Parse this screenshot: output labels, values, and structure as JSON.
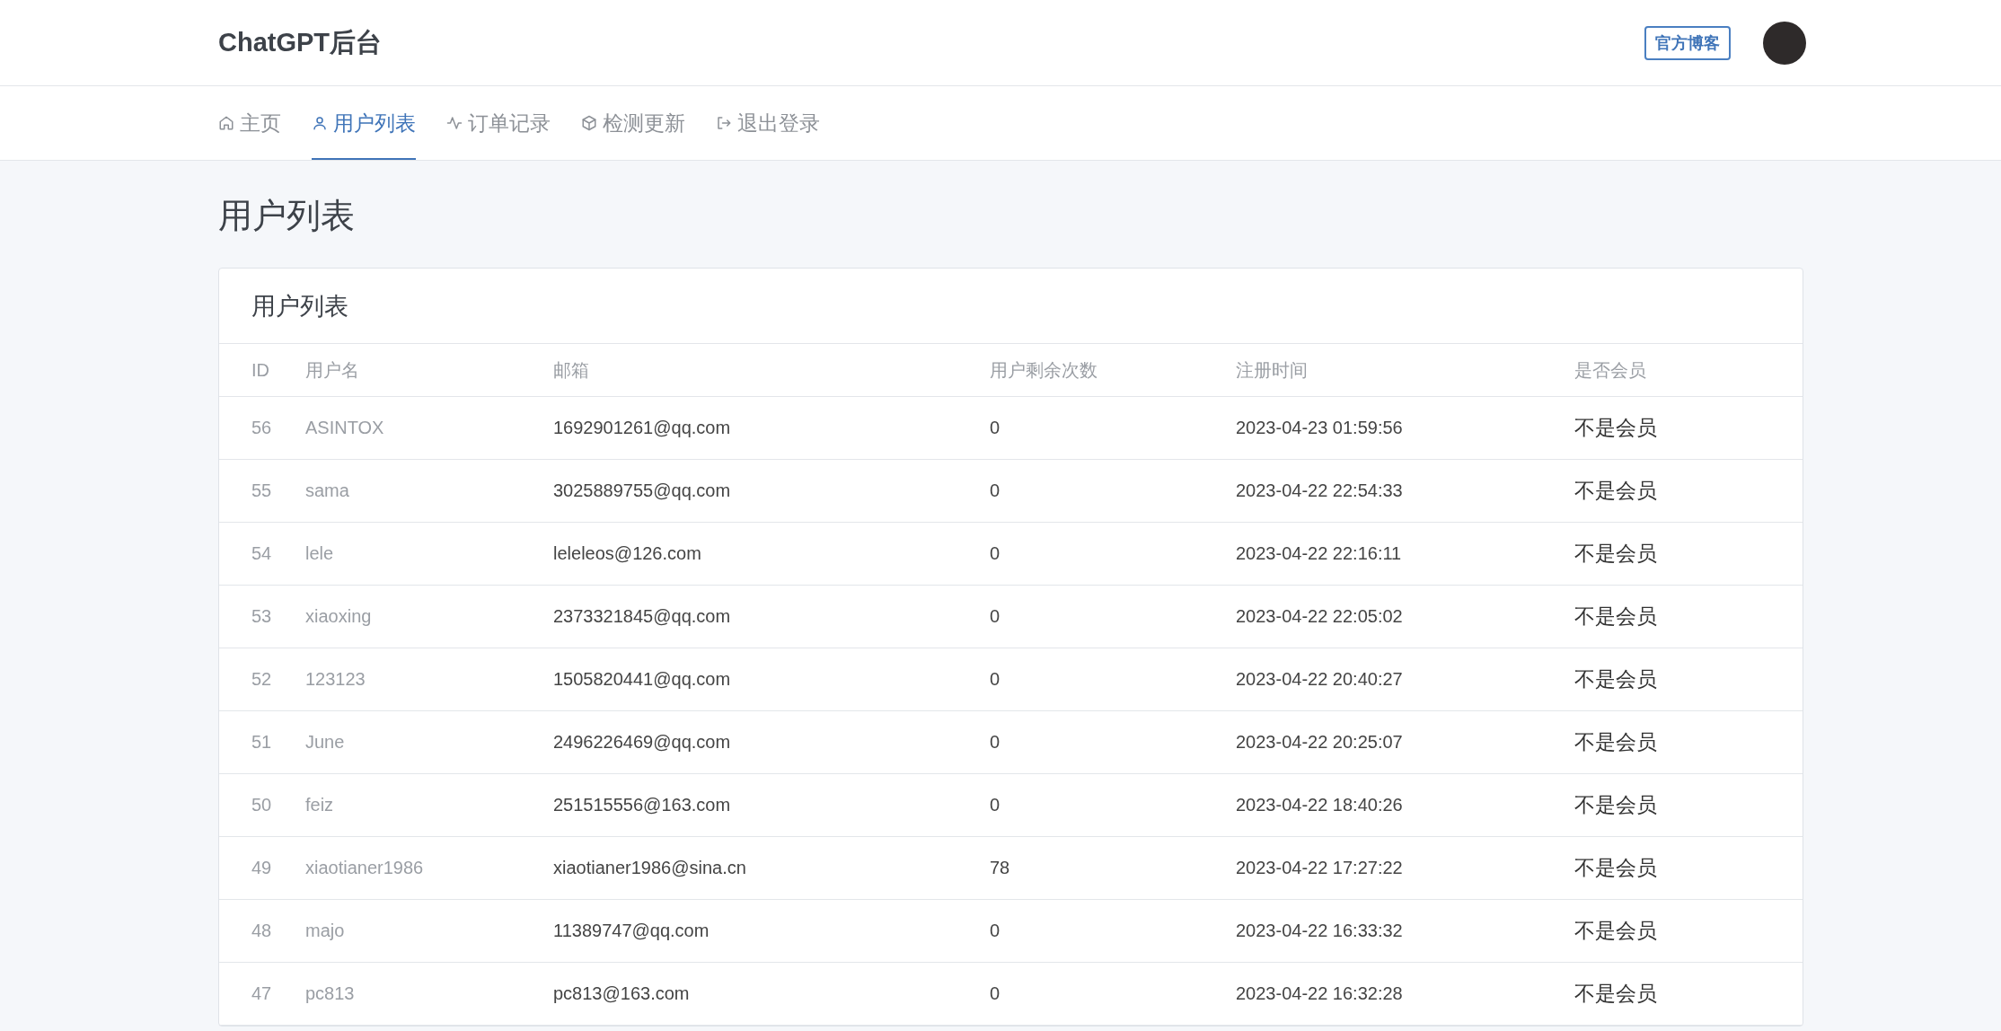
{
  "header": {
    "brand": "ChatGPT后台",
    "blog_button": "官方博客"
  },
  "nav": [
    {
      "label": "主页",
      "selected": false
    },
    {
      "label": "用户列表",
      "selected": true
    },
    {
      "label": "订单记录",
      "selected": false
    },
    {
      "label": "检测更新",
      "selected": false
    },
    {
      "label": "退出登录",
      "selected": false
    }
  ],
  "page_title": "用户列表",
  "card": {
    "title": "用户列表",
    "table": {
      "columns": [
        "ID",
        "用户名",
        "邮箱",
        "用户剩余次数",
        "注册时间",
        "是否会员"
      ],
      "rows": [
        [
          "56",
          "ASINTOX",
          "1692901261@qq.com",
          "0",
          "2023-04-23 01:59:56",
          "不是会员"
        ],
        [
          "55",
          "sama",
          "3025889755@qq.com",
          "0",
          "2023-04-22 22:54:33",
          "不是会员"
        ],
        [
          "54",
          "lele",
          "leleleos@126.com",
          "0",
          "2023-04-22 22:16:11",
          "不是会员"
        ],
        [
          "53",
          "xiaoxing",
          "2373321845@qq.com",
          "0",
          "2023-04-22 22:05:02",
          "不是会员"
        ],
        [
          "52",
          "123123",
          "1505820441@qq.com",
          "0",
          "2023-04-22 20:40:27",
          "不是会员"
        ],
        [
          "51",
          "June",
          "2496226469@qq.com",
          "0",
          "2023-04-22 20:25:07",
          "不是会员"
        ],
        [
          "50",
          "feiz",
          "251515556@163.com",
          "0",
          "2023-04-22 18:40:26",
          "不是会员"
        ],
        [
          "49",
          "xiaotianer1986",
          "xiaotianer1986@sina.cn",
          "78",
          "2023-04-22 17:27:22",
          "不是会员"
        ],
        [
          "48",
          "majo",
          "11389747@qq.com",
          "0",
          "2023-04-22 16:33:32",
          "不是会员"
        ],
        [
          "47",
          "pc813",
          "pc813@163.com",
          "0",
          "2023-04-22 16:32:28",
          "不是会员"
        ]
      ]
    }
  }
}
